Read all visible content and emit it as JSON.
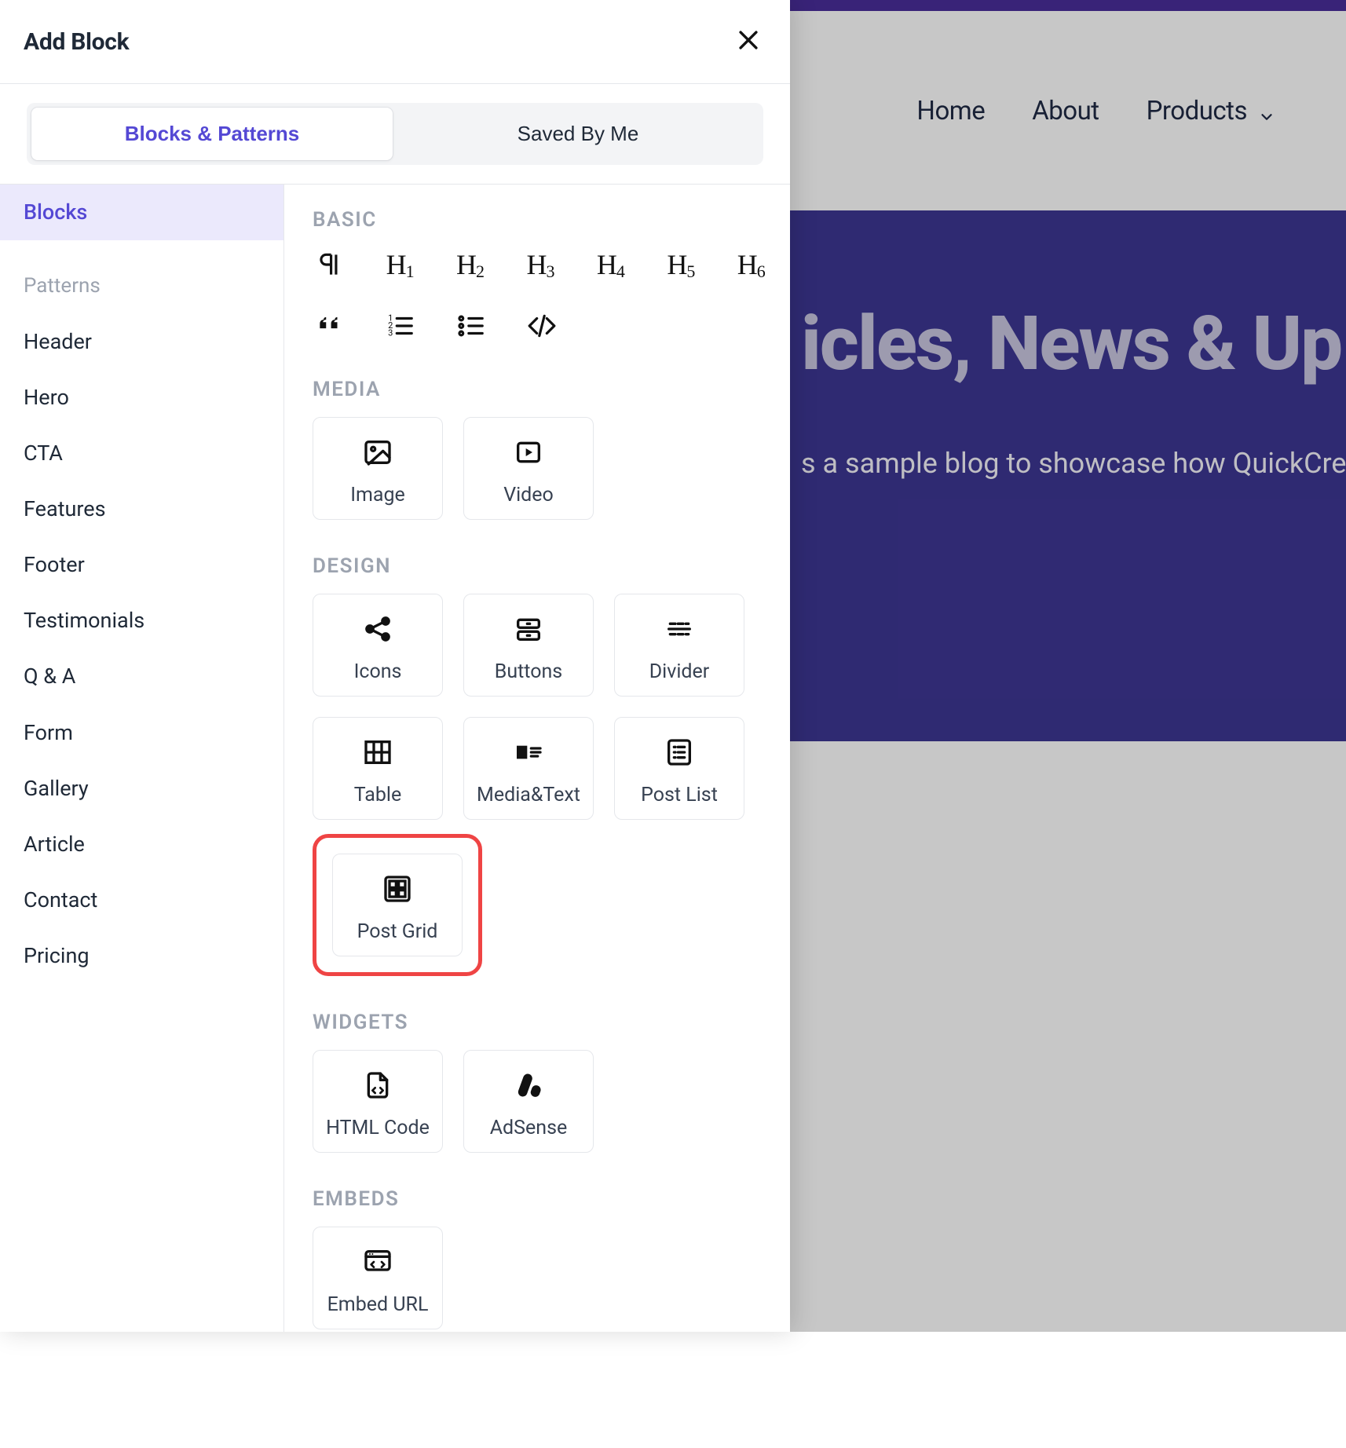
{
  "panel": {
    "title": "Add Block",
    "tabs": {
      "blocks_patterns": "Blocks & Patterns",
      "saved": "Saved By Me"
    }
  },
  "sidebar": {
    "blocks": "Blocks",
    "patterns_heading": "Patterns",
    "patterns": [
      "Header",
      "Hero",
      "CTA",
      "Features",
      "Footer",
      "Testimonials",
      "Q & A",
      "Form",
      "Gallery",
      "Article",
      "Contact",
      "Pricing"
    ]
  },
  "sections": {
    "basic": {
      "title": "BASIC",
      "row1_names": [
        "paragraph",
        "h1",
        "h2",
        "h3",
        "h4",
        "h5",
        "h6"
      ],
      "row2_names": [
        "quote",
        "ordered-list",
        "unordered-list",
        "code"
      ]
    },
    "media": {
      "title": "MEDIA",
      "image": "Image",
      "video": "Video"
    },
    "design": {
      "title": "DESIGN",
      "icons": "Icons",
      "buttons": "Buttons",
      "divider": "Divider",
      "table": "Table",
      "mediatext": "Media&Text",
      "postlist": "Post List",
      "postgrid": "Post Grid"
    },
    "widgets": {
      "title": "WIDGETS",
      "html": "HTML Code",
      "adsense": "AdSense"
    },
    "embeds": {
      "title": "EMBEDS",
      "embedurl": "Embed URL"
    }
  },
  "site": {
    "nav": {
      "home": "Home",
      "about": "About",
      "products": "Products"
    },
    "hero_title": "icles, News & Up",
    "hero_sub": "s a sample blog to showcase how QuickCre"
  }
}
